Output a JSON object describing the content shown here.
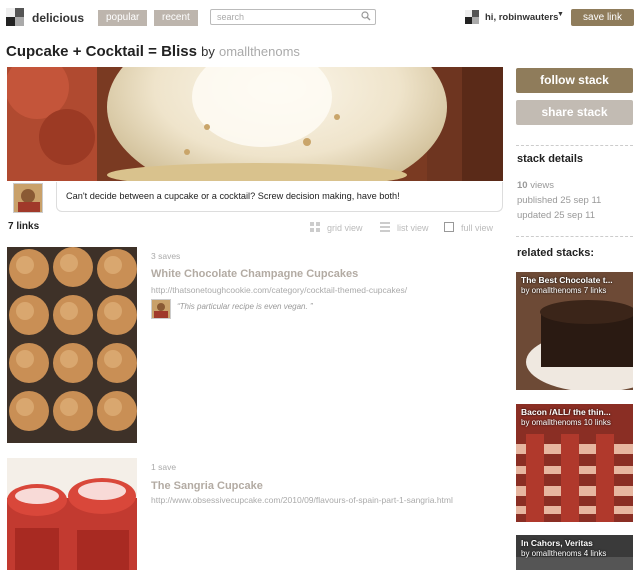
{
  "header": {
    "brand": "delicious",
    "tabs": [
      "popular",
      "recent"
    ],
    "search_placeholder": "search",
    "user_greeting": "hi, robinwauters",
    "save_link_label": "save link"
  },
  "stack": {
    "title": "Cupcake + Cocktail = Bliss",
    "by_label": "by",
    "author": "omallthenoms",
    "description": "Can't decide between a cupcake or a cocktail? Screw decision making, have both!",
    "link_count": "7 links",
    "views": [
      "grid view",
      "list view",
      "full view"
    ]
  },
  "links": [
    {
      "saves": "3 saves",
      "title": "White Chocolate Champagne Cupcakes",
      "url": "http://thatsonetoughcookie.com/category/cocktail-themed-cupcakes/",
      "comment": "“This particular recipe is even vegan. ”"
    },
    {
      "saves": "1 save",
      "title": "The Sangria Cupcake",
      "url": "http://www.obsessivecupcake.com/2010/09/flavours-of-spain-part-1-sangria.html"
    }
  ],
  "sidebar": {
    "follow_label": "follow stack",
    "share_label": "share stack",
    "details_heading": "stack details",
    "views_count": "10",
    "views_label": "views",
    "published": "published 25 sep 11",
    "updated": "updated 25 sep 11",
    "related_heading": "related stacks:",
    "related": [
      {
        "title": "The Best Chocolate t...",
        "byline": "by omallthenoms 7 links"
      },
      {
        "title": "Bacon /ALL/ the thin...",
        "byline": "by omallthenoms 10 links"
      },
      {
        "title": "In Cahors, Veritas",
        "byline": "by omallthenoms 4 links"
      }
    ]
  },
  "colors": {
    "accent": "#8f7c5b",
    "muted_button": "#c2bbb3",
    "tab_bg": "#bdb5ad"
  }
}
